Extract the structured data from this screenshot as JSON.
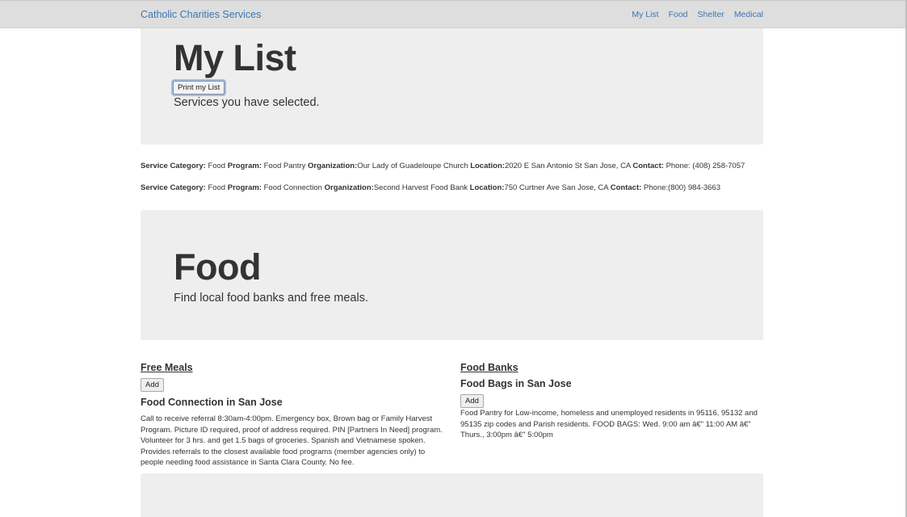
{
  "navbar": {
    "brand": "Catholic Charities Services",
    "links": [
      "My List",
      "Food",
      "Shelter",
      "Medical"
    ]
  },
  "mylist": {
    "title": "My List",
    "print_label": "Print my List",
    "lead": "Services you have selected."
  },
  "selected": [
    {
      "category_label": "Service Category:",
      "category": "Food",
      "program_label": "Program:",
      "program": "Food Pantry",
      "org_label": "Organization:",
      "org": "Our Lady of Guadeloupe Church",
      "location_label": "Location:",
      "location": "2020 E San Antonio St San Jose, CA",
      "contact_label": "Contact:",
      "contact": "Phone: (408) 258-7057"
    },
    {
      "category_label": "Service Category:",
      "category": "Food",
      "program_label": "Program:",
      "program": "Food Connection",
      "org_label": "Organization:",
      "org": "Second Harvest Food Bank",
      "location_label": "Location:",
      "location": "750 Curtner Ave San Jose, CA",
      "contact_label": "Contact:",
      "contact": "Phone:(800) 984-3663"
    }
  ],
  "food": {
    "title": "Food",
    "lead": "Find local food banks and free meals."
  },
  "free_meals": {
    "heading": "Free Meals",
    "add_label": "Add",
    "item_title": "Food Connection in San Jose",
    "description": "Call to receive referral 8:30am-4:00pm. Emergency box, Brown bag or Family Harvest Program. Picture ID required, proof of address required. PIN [Partners In Need] program. Volunteer for 3 hrs. and get 1.5 bags of groceries. Spanish and Vietnamese spoken. Provides referrals to the closest available food programs (member agencies only) to people needing food assistance in Santa Clara County. No fee."
  },
  "food_banks": {
    "heading": "Food Banks",
    "item_title": "Food Bags in San Jose",
    "add_label": "Add",
    "description": "Food Pantry for Low-income, homeless and unemployed residents in 95116, 95132 and 95135 zip codes and Parish residents. FOOD BAGS: Wed. 9:00 am â€\" 11:00 AM â€\" Thurs., 3:00pm â€\" 5:00pm"
  }
}
